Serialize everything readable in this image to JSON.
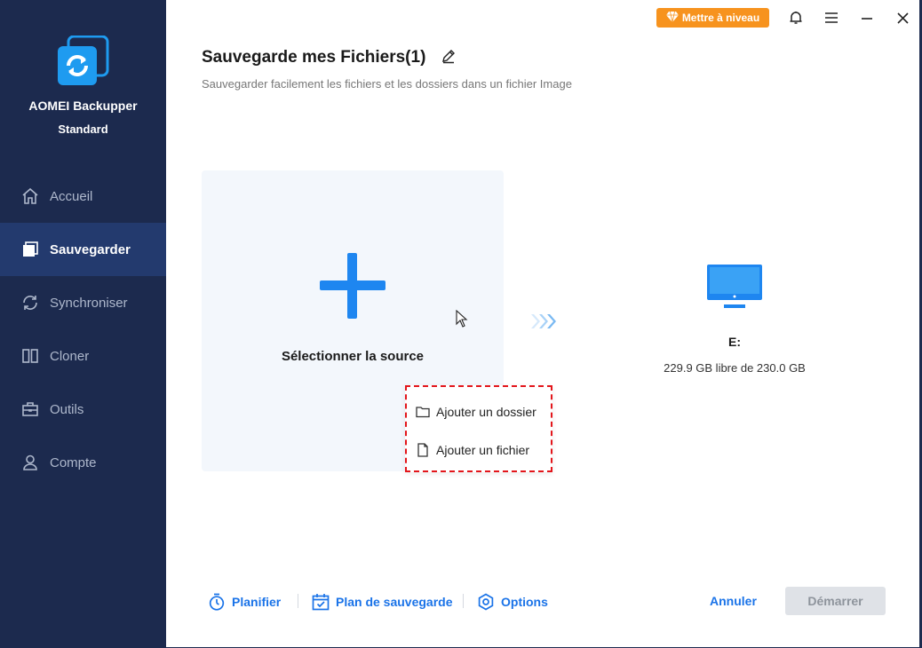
{
  "app": {
    "name": "AOMEI Backupper",
    "edition": "Standard"
  },
  "sidebar": {
    "items": [
      {
        "label": "Accueil",
        "icon": "home-icon",
        "active": false
      },
      {
        "label": "Sauvegarder",
        "icon": "backup-icon",
        "active": true
      },
      {
        "label": "Synchroniser",
        "icon": "sync-icon",
        "active": false
      },
      {
        "label": "Cloner",
        "icon": "clone-icon",
        "active": false
      },
      {
        "label": "Outils",
        "icon": "tools-icon",
        "active": false
      },
      {
        "label": "Compte",
        "icon": "user-icon",
        "active": false
      }
    ]
  },
  "topbar": {
    "upgrade_label": "Mettre à niveau",
    "upgrade_color": "#f7931e"
  },
  "page": {
    "title": "Sauvegarde mes Fichiers(1)",
    "subtitle": "Sauvegarder facilement les fichiers et les dossiers dans un fichier Image"
  },
  "source": {
    "label": "Sélectionner la source",
    "menu": [
      {
        "label": "Ajouter un dossier",
        "icon": "folder-icon"
      },
      {
        "label": "Ajouter un fichier",
        "icon": "file-icon"
      }
    ]
  },
  "destination": {
    "name": "E:",
    "space": "229.9 GB libre de 230.0 GB"
  },
  "bottom": {
    "schedule": "Planifier",
    "scheme": "Plan de sauvegarde",
    "options": "Options",
    "cancel": "Annuler",
    "start": "Démarrer"
  },
  "colors": {
    "sidebar_bg": "#1c2a4e",
    "active_bg": "#233a6e",
    "accent": "#1a73e8"
  }
}
